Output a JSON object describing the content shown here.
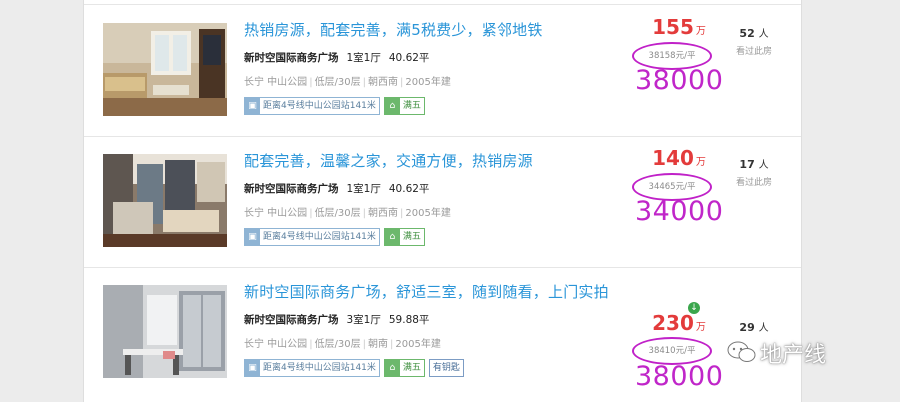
{
  "listings": [
    {
      "title": "热销房源，配套完善，满5税费少，紧邻地铁",
      "community": "新时空国际商务广场",
      "layout": "1室1厅",
      "area": "40.62平",
      "district": "长宁 中山公园",
      "floor": "低层/30层",
      "orientation": "朝西南",
      "year": "2005年建",
      "subway_tag": "距离4号线中山公园站141米",
      "tax_tag": "满五",
      "extra_tag": "",
      "price": "155",
      "price_unit": "万",
      "unit_price": "38158元/平",
      "annotation": "38000",
      "viewers": "52",
      "viewers_unit": "人",
      "viewers_label": "看过此房",
      "price_drop_icon": false
    },
    {
      "title": "配套完善，温馨之家，交通方便，热销房源",
      "community": "新时空国际商务广场",
      "layout": "1室1厅",
      "area": "40.62平",
      "district": "长宁 中山公园",
      "floor": "低层/30层",
      "orientation": "朝西南",
      "year": "2005年建",
      "subway_tag": "距离4号线中山公园站141米",
      "tax_tag": "满五",
      "extra_tag": "",
      "price": "140",
      "price_unit": "万",
      "unit_price": "34465元/平",
      "annotation": "34000",
      "viewers": "17",
      "viewers_unit": "人",
      "viewers_label": "看过此房",
      "price_drop_icon": false
    },
    {
      "title": "新时空国际商务广场，舒适三室，随到随看，上门实拍",
      "community": "新时空国际商务广场",
      "layout": "3室1厅",
      "area": "59.88平",
      "district": "长宁 中山公园",
      "floor": "低层/30层",
      "orientation": "朝南",
      "year": "2005年建",
      "subway_tag": "距离4号线中山公园站141米",
      "tax_tag": "满五",
      "extra_tag": "有钥匙",
      "price": "230",
      "price_unit": "万",
      "unit_price": "38410元/平",
      "annotation": "38000",
      "viewers": "29",
      "viewers_unit": "人",
      "viewers_label": "",
      "price_drop_icon": true
    }
  ],
  "watermark": "地产线",
  "icons": {
    "subway": "subway-icon",
    "tax": "house-tax-icon",
    "price_drop": "price-down-arrow-icon",
    "wechat": "wechat-icon"
  },
  "colors": {
    "title": "#2a95d8",
    "price": "#e33b3b",
    "annotation": "#c026c9",
    "subway_tag": "#8fb4d4",
    "tax_tag": "#6cb86c"
  }
}
